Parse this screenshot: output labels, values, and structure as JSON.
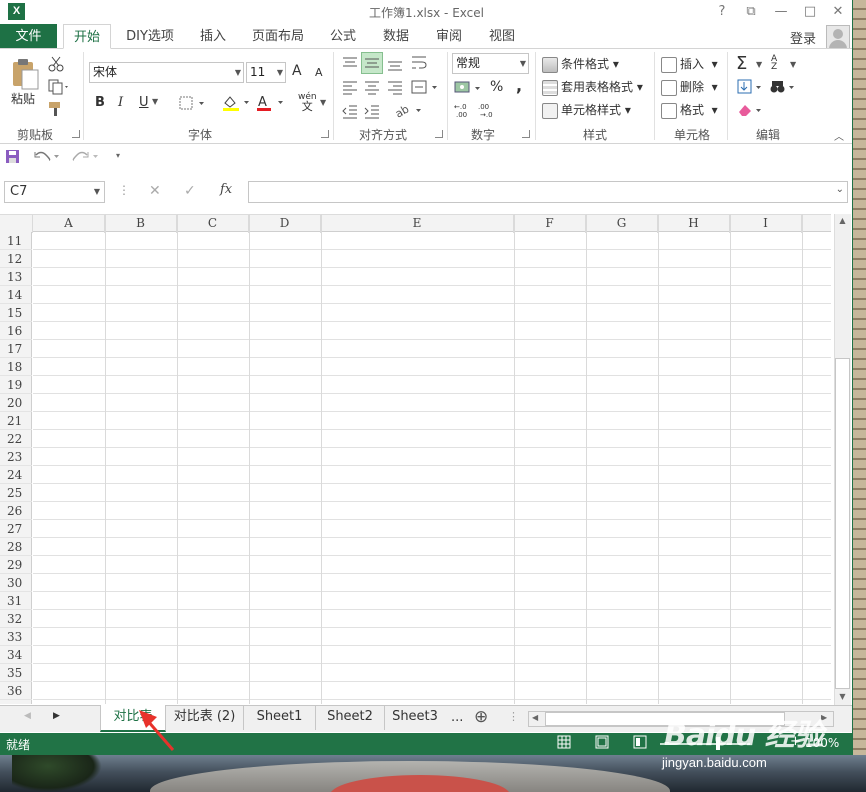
{
  "window": {
    "title": "工作簿1.xlsx - Excel",
    "help": "?",
    "restore": "⧉",
    "minimize": "—",
    "maximize": "□",
    "close": "✕",
    "app_icon": "X"
  },
  "tabs": [
    {
      "label": "文件"
    },
    {
      "label": "开始"
    },
    {
      "label": "DIY选项"
    },
    {
      "label": "插入"
    },
    {
      "label": "页面布局"
    },
    {
      "label": "公式"
    },
    {
      "label": "数据"
    },
    {
      "label": "审阅"
    },
    {
      "label": "视图"
    }
  ],
  "login": "登录",
  "ribbon": {
    "clipboard": {
      "label": "剪贴板",
      "paste": "粘贴"
    },
    "font": {
      "label": "字体",
      "name": "宋体",
      "size": "11",
      "bold": "B",
      "italic": "I",
      "underline": "U",
      "grow": "A",
      "shrink": "A",
      "phonetic_top": "wén",
      "phonetic_bottom": "文"
    },
    "align": {
      "label": "对齐方式"
    },
    "number": {
      "label": "数字",
      "format": "常规",
      "percent": "%",
      "comma": ","
    },
    "styles": {
      "label": "样式",
      "cond": "条件格式",
      "table": "套用表格格式",
      "cell": "单元格样式"
    },
    "cells": {
      "label": "单元格",
      "insert": "插入",
      "delete": "删除",
      "format": "格式"
    },
    "editing": {
      "label": "编辑",
      "sigma": "Σ",
      "sort": "A Z"
    }
  },
  "formula_bar": {
    "name_box": "C7",
    "fx": "fx",
    "cancel": "✕",
    "enter": "✓",
    "value": ""
  },
  "grid": {
    "columns": [
      "A",
      "B",
      "C",
      "D",
      "E",
      "F",
      "G",
      "H",
      "I"
    ],
    "rows": [
      "11",
      "12",
      "13",
      "14",
      "15",
      "16",
      "17",
      "18",
      "19",
      "20",
      "21",
      "22",
      "23",
      "24",
      "25",
      "26",
      "27",
      "28",
      "29",
      "30",
      "31",
      "32",
      "33",
      "34",
      "35",
      "36"
    ]
  },
  "sheets": [
    {
      "label": "对比表"
    },
    {
      "label": "对比表 (2)"
    },
    {
      "label": "Sheet1"
    },
    {
      "label": "Sheet2"
    },
    {
      "label": "Sheet3"
    }
  ],
  "sheets_more": "...",
  "add_sheet": "⊕",
  "status": {
    "ready": "就绪",
    "zoom": "100%"
  },
  "watermark": {
    "logo": "Baidu 经验",
    "url": "jingyan.baidu.com"
  },
  "colors": {
    "accent": "#217346",
    "arrow": "#e8322b"
  }
}
